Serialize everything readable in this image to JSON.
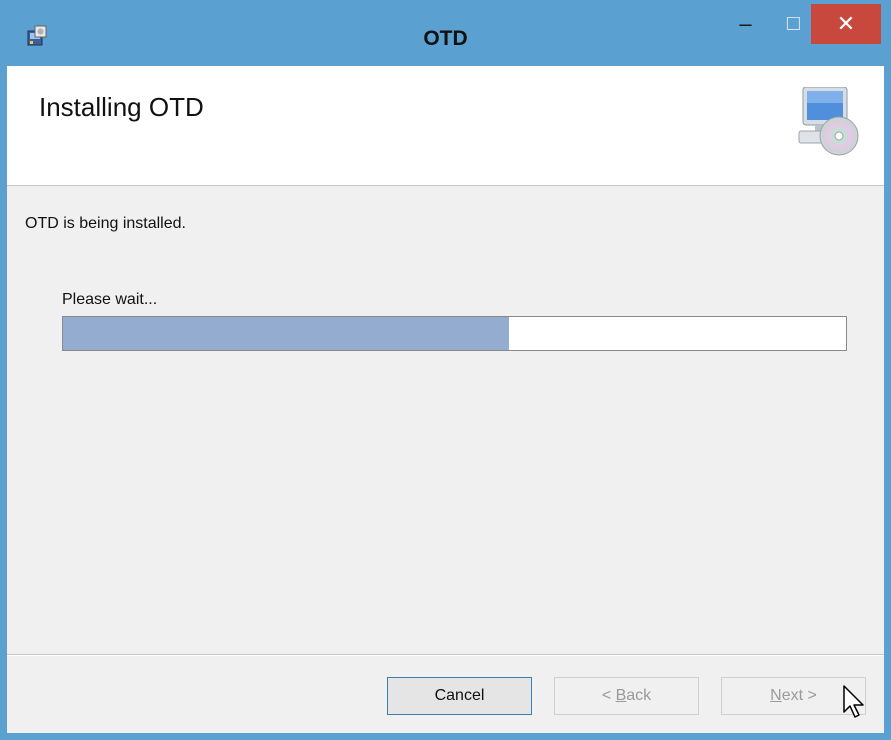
{
  "window": {
    "title": "OTD",
    "controls": {
      "minimize": "–",
      "maximize": "☐",
      "close": "✕"
    },
    "app_icon": "installer-icon"
  },
  "header": {
    "title": "Installing OTD",
    "icon": "computer-cd-icon"
  },
  "body": {
    "status_text": "OTD is being installed.",
    "wait_text": "Please wait...",
    "progress_fraction": 0.57
  },
  "footer": {
    "cancel_label": "Cancel",
    "back_label_prefix": "< ",
    "back_accel": "B",
    "back_label_rest": "ack",
    "next_accel": "N",
    "next_label_rest": "ext >"
  },
  "colors": {
    "titlebar": "#5aa0d0",
    "close_button": "#c9483d",
    "progress_fill": "#93acd0"
  }
}
